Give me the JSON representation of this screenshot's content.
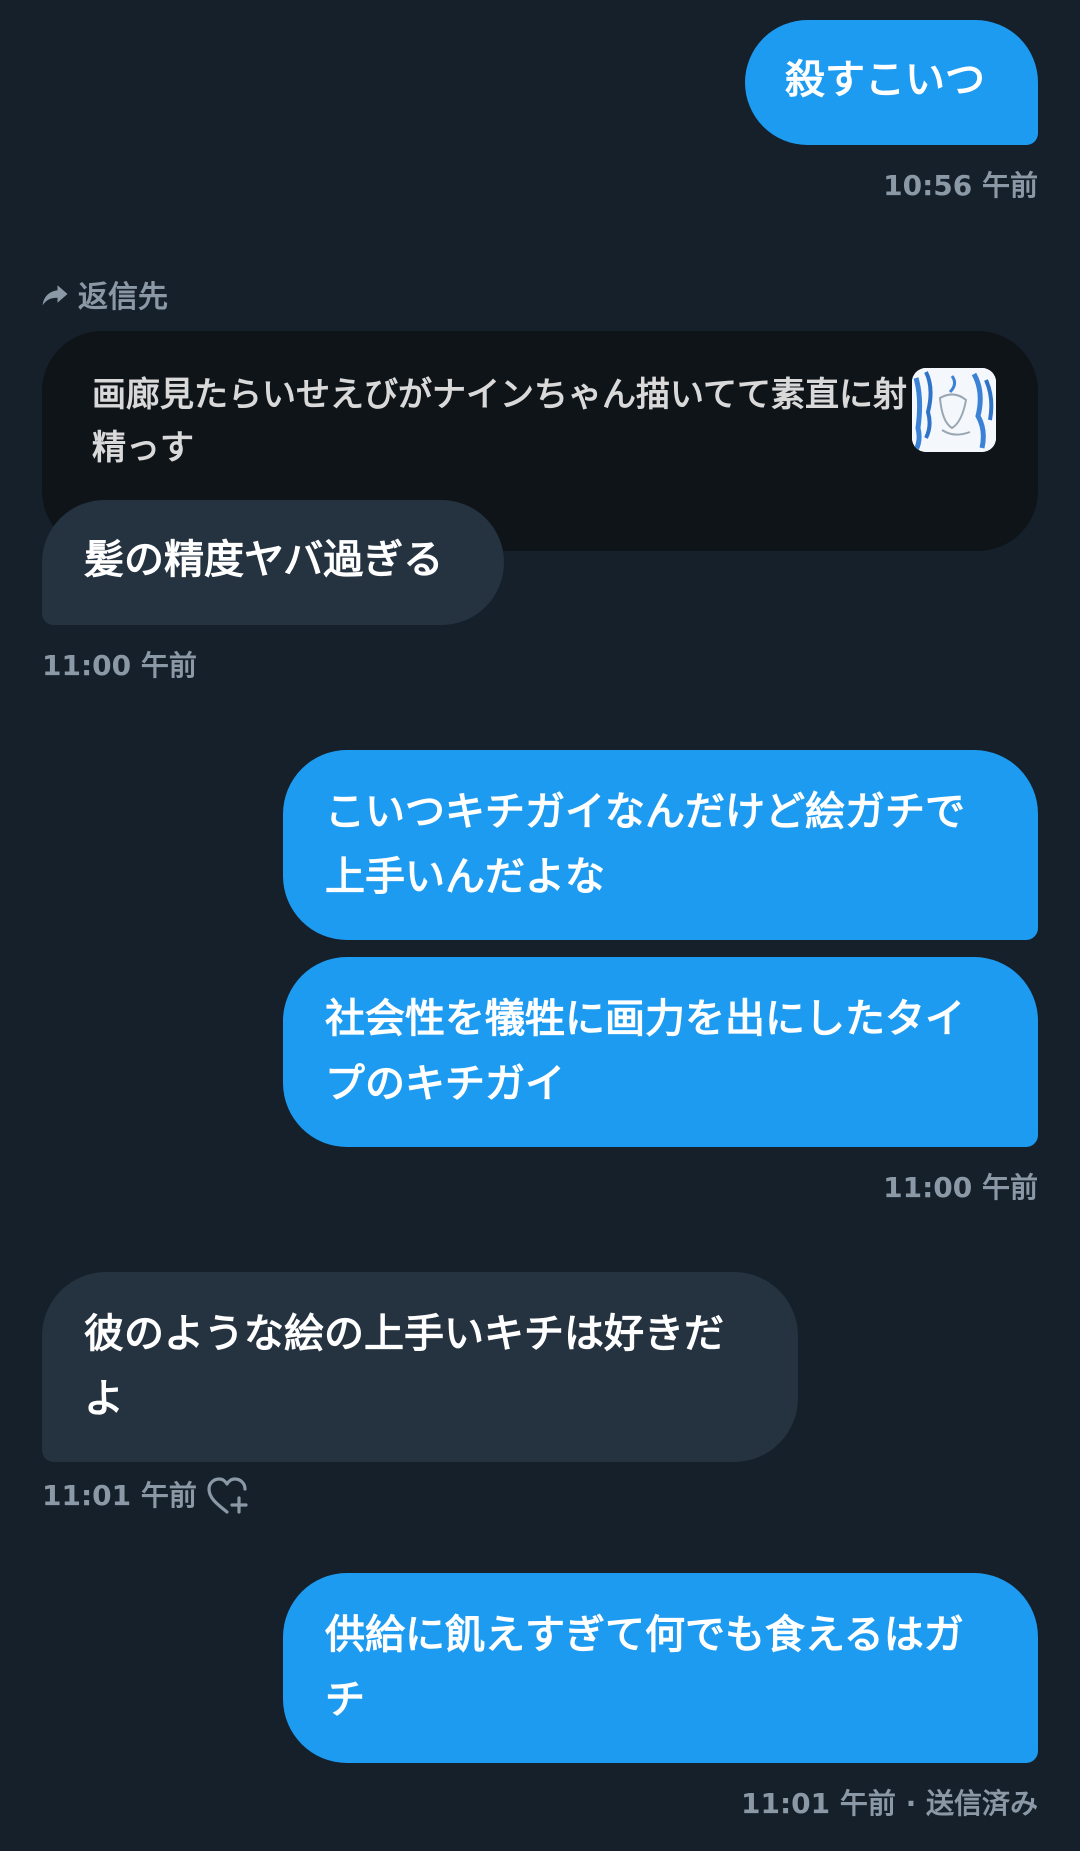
{
  "messages": {
    "m1": {
      "text": "殺すこいつ",
      "time": "10:56 午前"
    },
    "reply": {
      "label": "返信先",
      "quoted_text": "画廊見たらいせえびがナインちゃん描いてて素直に射精っす",
      "text": "髪の精度ヤバ過ぎる",
      "time": "11:00 午前"
    },
    "m3": {
      "text": "こいつキチガイなんだけど絵ガチで上手いんだよな"
    },
    "m4": {
      "text": "社会性を犠牲に画力を出にしたタイプのキチガイ",
      "time": "11:00 午前"
    },
    "m5": {
      "text": "彼のような絵の上手いキチは好きだよ",
      "time": "11:01 午前"
    },
    "m6": {
      "text": "供給に飢えすぎて何でも食えるはガチ",
      "time": "11:01 午前 · 送信済み"
    }
  },
  "icons": {
    "reply": "reply-arrow-icon",
    "like": "heart-plus-icon",
    "thumbnail": "image-thumbnail-icon"
  },
  "colors": {
    "background": "#15202b",
    "outgoing_bubble": "#1d9bf0",
    "incoming_bubble": "#253341",
    "quote_card": "#0f1419",
    "meta_text": "#8b98a5"
  }
}
